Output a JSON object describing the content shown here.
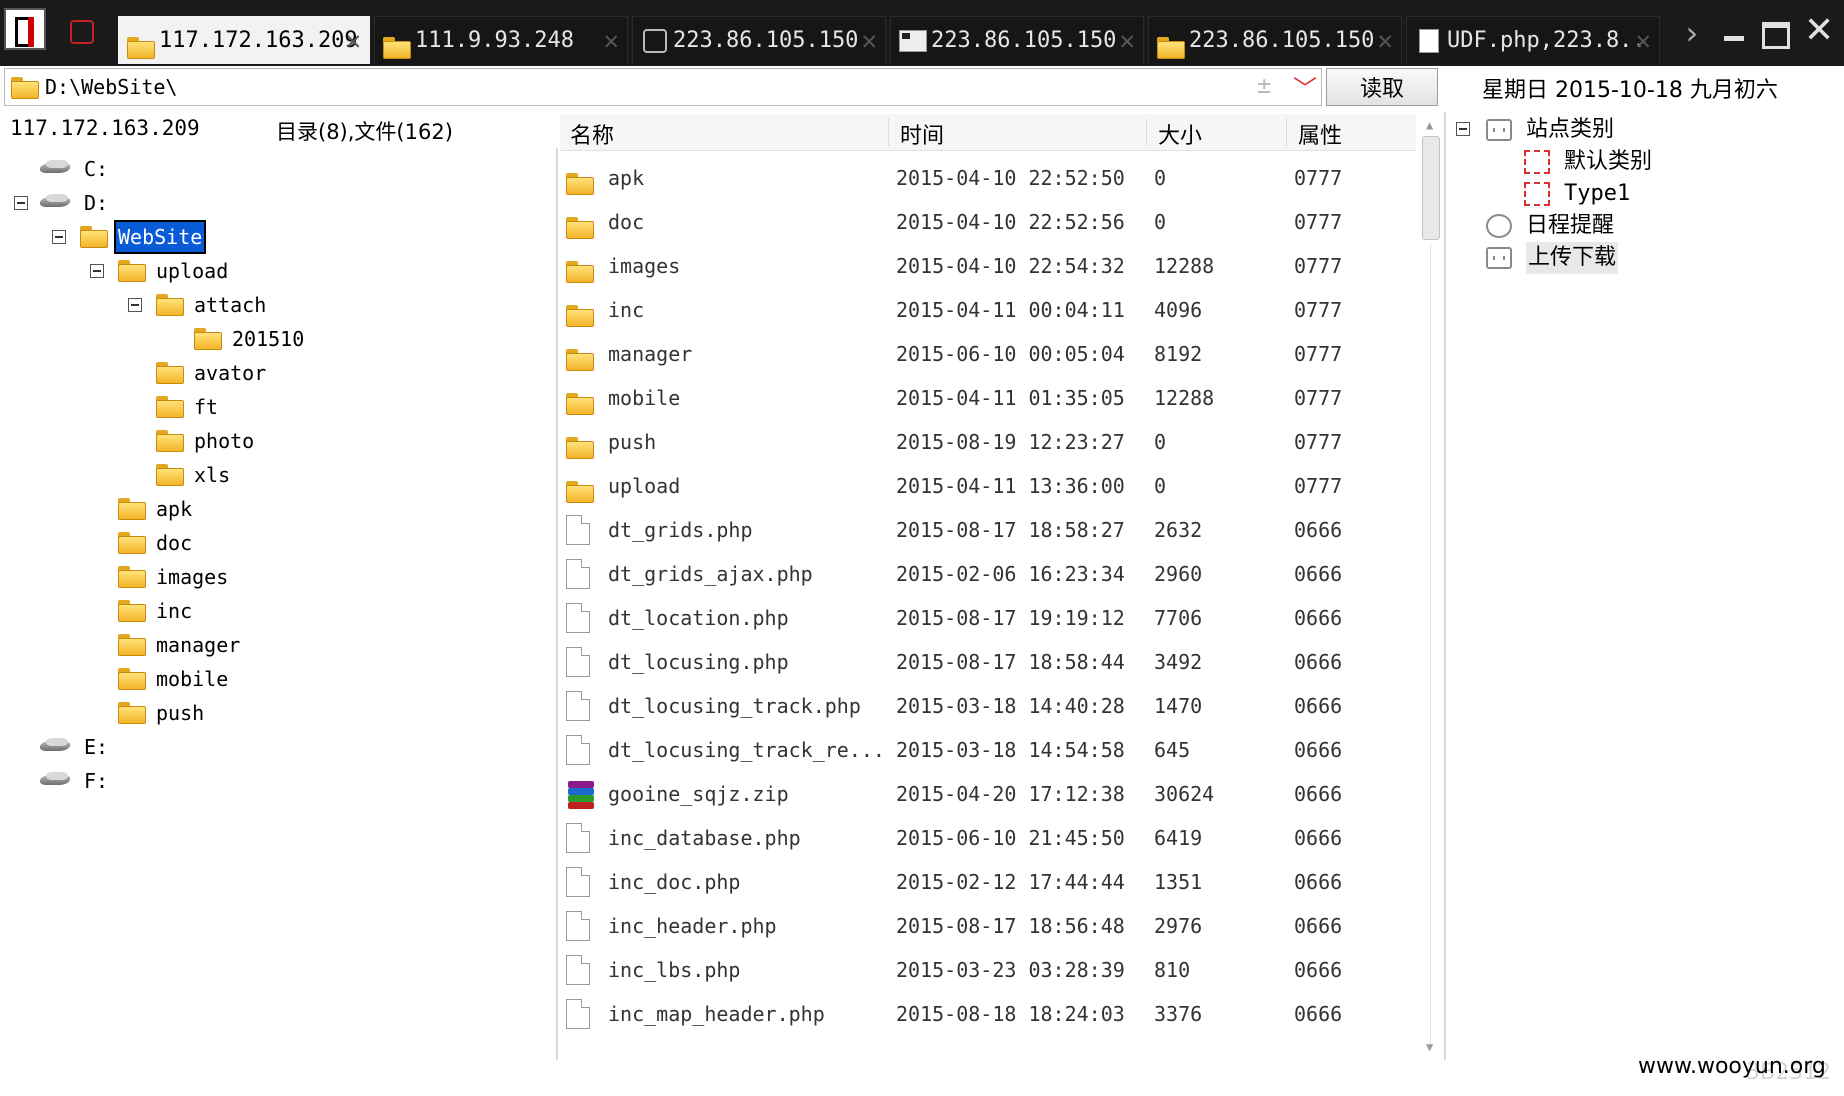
{
  "tabs": [
    {
      "label": "117.172.163.209",
      "icon": "folder-icon",
      "active": true
    },
    {
      "label": "111.9.93.248",
      "icon": "folder-icon",
      "active": false
    },
    {
      "label": "223.86.105.150",
      "icon": "database-icon",
      "active": false
    },
    {
      "label": "223.86.105.150",
      "icon": "terminal-icon",
      "active": false
    },
    {
      "label": "223.86.105.150",
      "icon": "folder-icon",
      "active": false
    },
    {
      "label": "UDF.php,223.8..",
      "icon": "file-icon",
      "active": false
    }
  ],
  "tab_close_glyph": "✕",
  "tab_more_glyph": "›",
  "address": {
    "value": "D:\\WebSite\\",
    "plus_glyph": "±",
    "dropdown_glyph": "﹀",
    "read_label": "读取"
  },
  "date_label": "星期日 2015-10-18 九月初六",
  "left_panel": {
    "host": "117.172.163.209",
    "count": "目录(8),文件(162)"
  },
  "tree": [
    {
      "label": "C:",
      "type": "drive"
    },
    {
      "label": "D:",
      "type": "drive",
      "expanded": true
    },
    {
      "label": "WebSite",
      "type": "folder",
      "selected": true
    },
    {
      "label": "upload",
      "type": "folder"
    },
    {
      "label": "attach",
      "type": "folder"
    },
    {
      "label": "201510",
      "type": "folder"
    },
    {
      "label": "avator",
      "type": "folder"
    },
    {
      "label": "ft",
      "type": "folder"
    },
    {
      "label": "photo",
      "type": "folder"
    },
    {
      "label": "xls",
      "type": "folder"
    },
    {
      "label": "apk",
      "type": "folder"
    },
    {
      "label": "doc",
      "type": "folder"
    },
    {
      "label": "images",
      "type": "folder"
    },
    {
      "label": "inc",
      "type": "folder"
    },
    {
      "label": "manager",
      "type": "folder"
    },
    {
      "label": "mobile",
      "type": "folder"
    },
    {
      "label": "push",
      "type": "folder"
    },
    {
      "label": "E:",
      "type": "drive"
    },
    {
      "label": "F:",
      "type": "drive"
    }
  ],
  "columns": {
    "name": "名称",
    "time": "时间",
    "size": "大小",
    "attr": "属性"
  },
  "files": [
    {
      "name": "apk",
      "time": "2015-04-10 22:52:50",
      "size": "0",
      "attr": "0777",
      "icon": "folder-icon"
    },
    {
      "name": "doc",
      "time": "2015-04-10 22:52:56",
      "size": "0",
      "attr": "0777",
      "icon": "folder-icon"
    },
    {
      "name": "images",
      "time": "2015-04-10 22:54:32",
      "size": "12288",
      "attr": "0777",
      "icon": "folder-icon"
    },
    {
      "name": "inc",
      "time": "2015-04-11 00:04:11",
      "size": "4096",
      "attr": "0777",
      "icon": "folder-icon"
    },
    {
      "name": "manager",
      "time": "2015-06-10 00:05:04",
      "size": "8192",
      "attr": "0777",
      "icon": "folder-icon"
    },
    {
      "name": "mobile",
      "time": "2015-04-11 01:35:05",
      "size": "12288",
      "attr": "0777",
      "icon": "folder-icon"
    },
    {
      "name": "push",
      "time": "2015-08-19 12:23:27",
      "size": "0",
      "attr": "0777",
      "icon": "folder-icon"
    },
    {
      "name": "upload",
      "time": "2015-04-11 13:36:00",
      "size": "0",
      "attr": "0777",
      "icon": "folder-icon"
    },
    {
      "name": "dt_grids.php",
      "time": "2015-08-17 18:58:27",
      "size": "2632",
      "attr": "0666",
      "icon": "file-icon"
    },
    {
      "name": "dt_grids_ajax.php",
      "time": "2015-02-06 16:23:34",
      "size": "2960",
      "attr": "0666",
      "icon": "file-icon"
    },
    {
      "name": "dt_location.php",
      "time": "2015-08-17 19:19:12",
      "size": "7706",
      "attr": "0666",
      "icon": "file-icon"
    },
    {
      "name": "dt_locusing.php",
      "time": "2015-08-17 18:58:44",
      "size": "3492",
      "attr": "0666",
      "icon": "file-icon"
    },
    {
      "name": "dt_locusing_track.php",
      "time": "2015-03-18 14:40:28",
      "size": "1470",
      "attr": "0666",
      "icon": "file-icon"
    },
    {
      "name": "dt_locusing_track_re...",
      "time": "2015-03-18 14:54:58",
      "size": "645",
      "attr": "0666",
      "icon": "file-icon"
    },
    {
      "name": "gooine_sqjz.zip",
      "time": "2015-04-20 17:12:38",
      "size": "30624",
      "attr": "0666",
      "icon": "zip-icon"
    },
    {
      "name": "inc_database.php",
      "time": "2015-06-10 21:45:50",
      "size": "6419",
      "attr": "0666",
      "icon": "file-icon"
    },
    {
      "name": "inc_doc.php",
      "time": "2015-02-12 17:44:44",
      "size": "1351",
      "attr": "0666",
      "icon": "file-icon"
    },
    {
      "name": "inc_header.php",
      "time": "2015-08-17 18:56:48",
      "size": "2976",
      "attr": "0666",
      "icon": "file-icon"
    },
    {
      "name": "inc_lbs.php",
      "time": "2015-03-23 03:28:39",
      "size": "810",
      "attr": "0666",
      "icon": "file-icon"
    },
    {
      "name": "inc_map_header.php",
      "time": "2015-08-18 18:24:03",
      "size": "3376",
      "attr": "0666",
      "icon": "file-icon"
    }
  ],
  "right_tree": [
    {
      "label": "站点类别",
      "icon": "category-icon"
    },
    {
      "label": "默认类别",
      "icon": "red-category-icon"
    },
    {
      "label": "Type1",
      "icon": "red-category-icon"
    },
    {
      "label": "日程提醒",
      "icon": "clock-icon"
    },
    {
      "label": "上传下载",
      "icon": "transfer-icon"
    }
  ],
  "watermark": "www.wooyun.org",
  "watermark_faint": "3B2512"
}
